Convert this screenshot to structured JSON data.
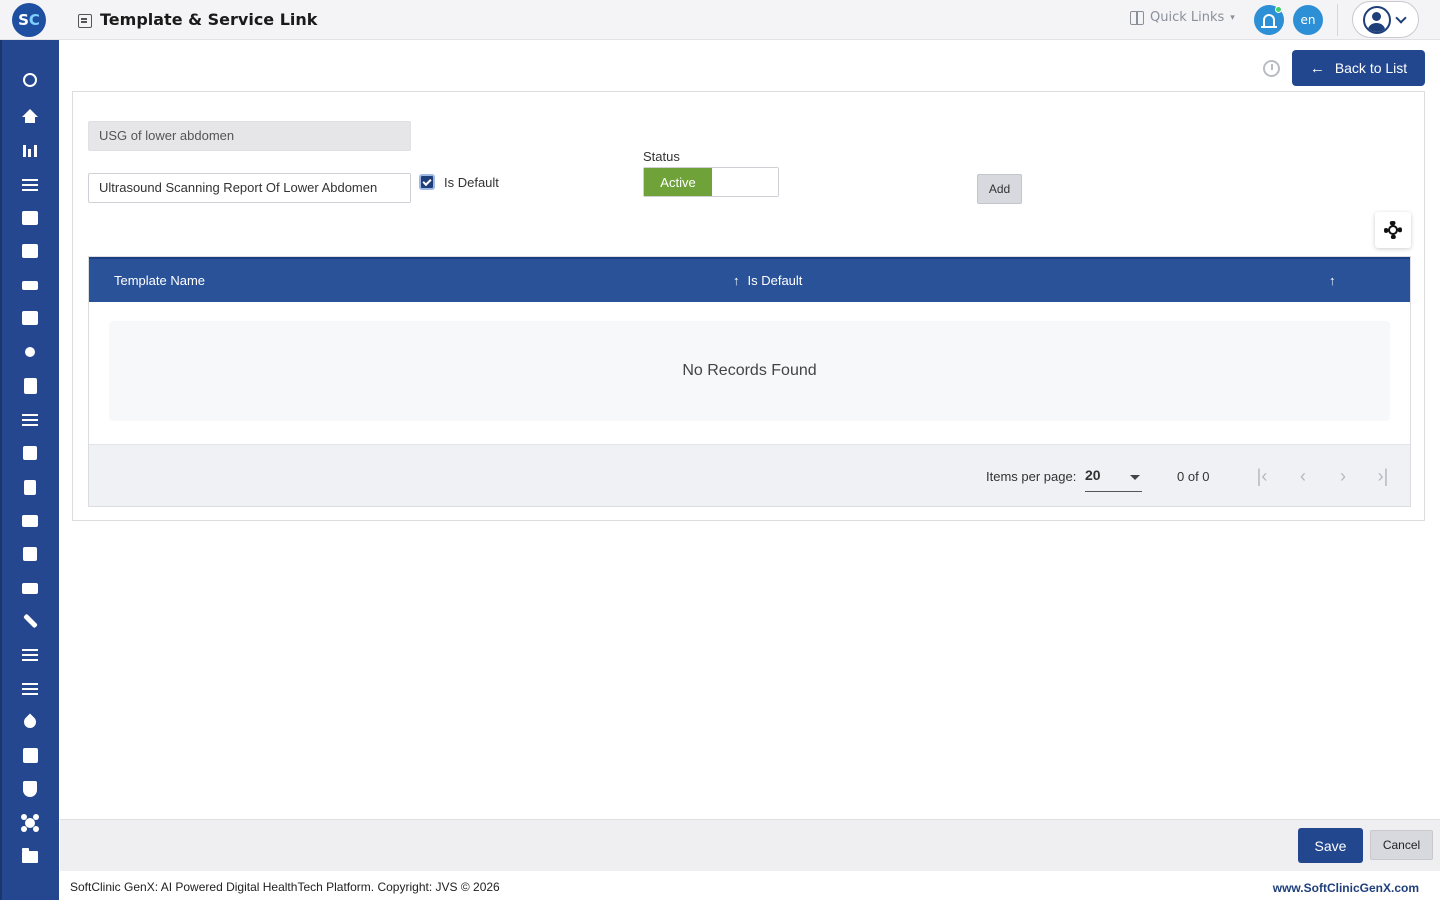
{
  "header": {
    "logo_s": "S",
    "logo_c": "C",
    "title": "Template & Service Link",
    "quick_links": "Quick Links",
    "language": "en"
  },
  "sidebar": {
    "icons": [
      "search-icon",
      "home-icon",
      "bar-chart-icon",
      "menu-icon",
      "medical-bag-icon",
      "calendar-icon",
      "bed-icon",
      "plus-box-icon",
      "user-icon",
      "document-icon",
      "list-icon",
      "medicine-icon",
      "pharmacy-icon",
      "book-icon",
      "building-icon",
      "devices-icon",
      "wrench-icon",
      "menu-icon",
      "menu-icon",
      "blood-drop-icon",
      "library-add-icon",
      "shield-icon",
      "hub-icon",
      "folder-icon"
    ]
  },
  "toolbar": {
    "back_label": "Back to List"
  },
  "form": {
    "service_value": "USG of lower abdomen",
    "template_value": "Ultrasound Scanning Report Of Lower Abdomen",
    "is_default_label": "Is Default",
    "is_default_checked": true,
    "status_label": "Status",
    "status_value": "Active",
    "add_label": "Add"
  },
  "table": {
    "columns": [
      "Template Name",
      "Is Default"
    ],
    "empty_message": "No Records Found",
    "paginator": {
      "items_per_page_label": "Items per page:",
      "items_per_page": "20",
      "range": "0 of 0"
    }
  },
  "actions": {
    "save_label": "Save",
    "cancel_label": "Cancel"
  },
  "footer": {
    "copyright": "SoftClinic GenX: AI Powered Digital HealthTech Platform. Copyright: JVS © 2026",
    "site": "www.SoftClinicGenX.com"
  },
  "colors": {
    "primary": "#22478f",
    "sidebar": "#24478f",
    "active_green": "#6fa33a",
    "notification": "#2d8fd5"
  }
}
